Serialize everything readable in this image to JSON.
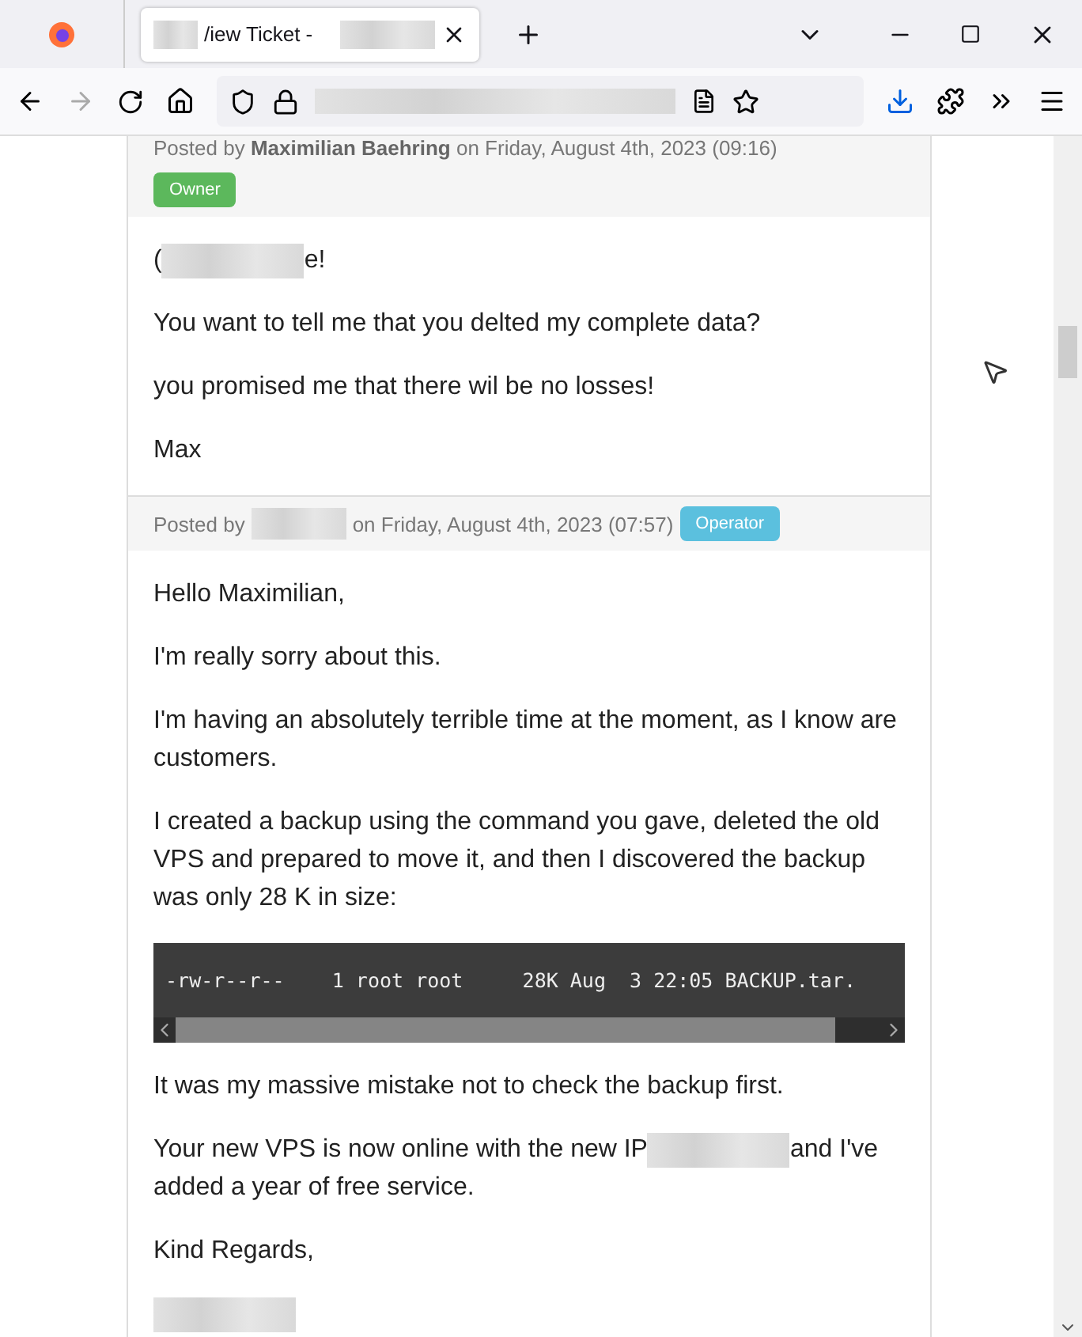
{
  "browser": {
    "tab_title": "/iew Ticket -"
  },
  "posts": [
    {
      "header": [
        {
          "kind": "text",
          "text": "Posted by **Maximilian Baehring** on Friday, August 4th, 2023 (09:16)"
        }
      ],
      "badge": {
        "label": "Owner",
        "color": "#5cb85c"
      },
      "badge_own_line": true,
      "body": [
        {
          "kind": "text",
          "parts": [
            {
              "kind": "text",
              "text": "("
            },
            {
              "kind": "redacted"
            },
            {
              "kind": "text",
              "text": "e!"
            }
          ]
        },
        {
          "kind": "text",
          "parts": [
            {
              "kind": "text",
              "text": "You want to tell me that you delted my complete data?"
            }
          ]
        },
        {
          "kind": "text",
          "parts": [
            {
              "kind": "text",
              "text": "you promised me that there wil be no losses!"
            }
          ]
        },
        {
          "kind": "text",
          "parts": [
            {
              "kind": "text",
              "text": "Max"
            }
          ]
        }
      ]
    },
    {
      "header": [
        {
          "kind": "text",
          "text": "Posted by"
        },
        {
          "kind": "redacted"
        },
        {
          "kind": "text",
          "text": "on Friday, August 4th, 2023 (07:57)"
        }
      ],
      "badge": {
        "label": "Operator",
        "color": "#5bc0de"
      },
      "badge_own_line": false,
      "body": [
        {
          "kind": "text",
          "parts": [
            {
              "kind": "text",
              "text": "Hello Maximilian,"
            }
          ]
        },
        {
          "kind": "text",
          "parts": [
            {
              "kind": "text",
              "text": "I'm really sorry about this."
            }
          ]
        },
        {
          "kind": "text",
          "parts": [
            {
              "kind": "text",
              "text": "I'm having an absolutely terrible time at the moment, as I know are customers."
            }
          ]
        },
        {
          "kind": "text",
          "parts": [
            {
              "kind": "text",
              "text": "I created a backup using the command you gave, deleted the old VPS and prepared to move it, and then I discovered the backup was only 28 K in size:"
            }
          ]
        },
        {
          "kind": "code",
          "text": " -rw-r--r--    1 root root     28K Aug  3 22:05 BACKUP.tar."
        },
        {
          "kind": "text",
          "parts": [
            {
              "kind": "text",
              "text": "It was my massive mistake not to check the backup first."
            }
          ]
        },
        {
          "kind": "text",
          "parts": [
            {
              "kind": "text",
              "text": "Your new VPS is now online with the new IP"
            },
            {
              "kind": "redacted"
            },
            {
              "kind": "text",
              "text": "and I've added a year of free service."
            }
          ]
        },
        {
          "kind": "text",
          "parts": [
            {
              "kind": "text",
              "text": "Kind Regards,"
            }
          ]
        },
        {
          "kind": "text",
          "parts": [
            {
              "kind": "redacted"
            }
          ]
        }
      ]
    }
  ]
}
